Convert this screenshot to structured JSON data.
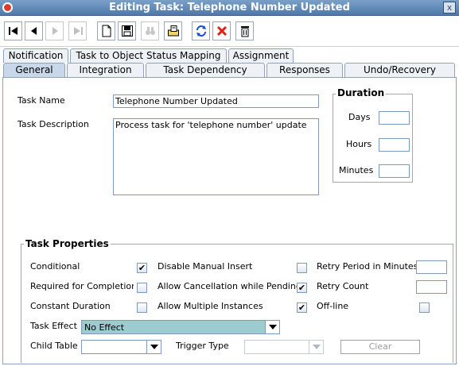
{
  "window": {
    "title": "Editing Task: Telephone Number Updated",
    "close_label": "x"
  },
  "toolbar": {
    "buttons": [
      {
        "name": "first-record",
        "icon": "skip-first-icon",
        "enabled": true
      },
      {
        "name": "previous-record",
        "icon": "previous-icon",
        "enabled": true
      },
      {
        "name": "next-record",
        "icon": "next-icon",
        "enabled": false
      },
      {
        "name": "last-record",
        "icon": "skip-last-icon",
        "enabled": false
      },
      {
        "name": "new",
        "icon": "new-document-icon",
        "enabled": true
      },
      {
        "name": "save",
        "icon": "save-icon",
        "enabled": true
      },
      {
        "name": "find",
        "icon": "binoculars-icon",
        "enabled": false
      },
      {
        "name": "assign",
        "icon": "assign-folder-icon",
        "enabled": true
      },
      {
        "name": "refresh",
        "icon": "refresh-icon",
        "enabled": true
      },
      {
        "name": "cancel",
        "icon": "cancel-icon",
        "enabled": true
      },
      {
        "name": "delete",
        "icon": "trash-icon",
        "enabled": true
      }
    ]
  },
  "tabs": {
    "row1": [
      "Notification",
      "Task to Object Status Mapping",
      "Assignment"
    ],
    "row2": [
      "General",
      "Integration",
      "Task Dependency",
      "Responses",
      "Undo/Recovery"
    ],
    "active": "General"
  },
  "general": {
    "task_name_label": "Task Name",
    "task_name_value": "Telephone Number Updated",
    "task_description_label": "Task Description",
    "task_description_value": "Process task for 'telephone number' update"
  },
  "duration": {
    "title": "Duration",
    "days_label": "Days",
    "hours_label": "Hours",
    "minutes_label": "Minutes",
    "days_value": "",
    "hours_value": "",
    "minutes_value": ""
  },
  "task_properties": {
    "title": "Task Properties",
    "conditional_label": "Conditional",
    "conditional_checked": "✔",
    "required_for_completion_label": "Required for Completion",
    "required_for_completion_checked": "",
    "constant_duration_label": "Constant Duration",
    "constant_duration_checked": "",
    "disable_manual_insert_label": "Disable Manual Insert",
    "disable_manual_insert_checked": "",
    "allow_cancellation_label": "Allow Cancellation while Pending",
    "allow_cancellation_checked": "✔",
    "allow_multiple_instances_label": "Allow Multiple Instances",
    "allow_multiple_instances_checked": "✔",
    "retry_period_label": "Retry Period in Minutes",
    "retry_period_value": "",
    "retry_count_label": "Retry Count",
    "retry_count_value": "",
    "offline_label": "Off-line",
    "offline_checked": "",
    "task_effect_label": "Task Effect",
    "task_effect_value": "No Effect",
    "child_table_label": "Child Table",
    "child_table_value": "",
    "trigger_type_label": "Trigger Type",
    "trigger_type_value": "",
    "clear_label": "Clear"
  },
  "colors": {
    "titlebar": "#5a82b0",
    "tab_active": "#c9d7ea",
    "task_effect_bg": "#9ccbd0"
  }
}
